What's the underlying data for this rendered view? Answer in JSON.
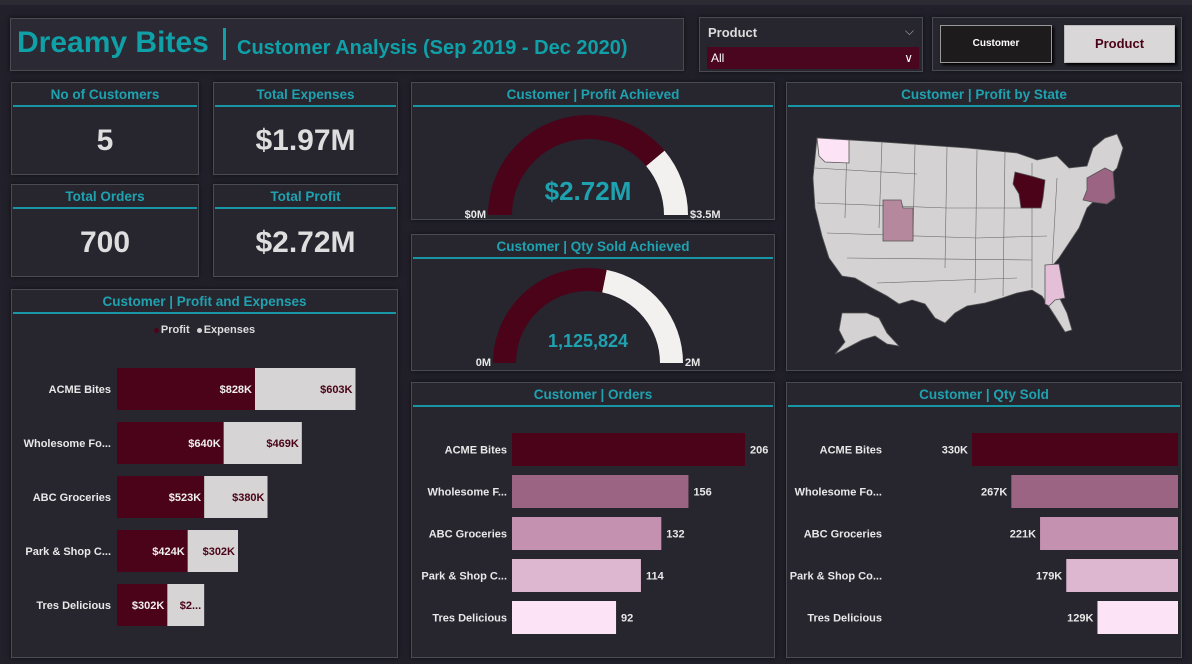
{
  "header": {
    "brand": "Dreamy Bites",
    "subtitle": "Customer Analysis (Sep 2019 - Dec 2020)"
  },
  "slicer": {
    "label": "Product",
    "value": "All"
  },
  "buttons": {
    "customer": "Customer",
    "product": "Product"
  },
  "kpis": [
    {
      "title": "No of Customers",
      "value": "5"
    },
    {
      "title": "Total Expenses",
      "value": "$1.97M"
    },
    {
      "title": "Total Orders",
      "value": "700"
    },
    {
      "title": "Total Profit",
      "value": "$2.72M"
    }
  ],
  "colors": {
    "accent": "#1fa2b0",
    "maroon": "#4a0318",
    "gauge_bg": "#f3f1ef"
  },
  "chart_data": [
    {
      "id": "profit-gauge",
      "type": "gauge",
      "title": "Customer | Profit Achieved",
      "value": 2720000,
      "min": 0,
      "max": 3500000,
      "value_label": "$2.72M",
      "min_label": "$0M",
      "max_label": "$3.5M"
    },
    {
      "id": "qty-gauge",
      "type": "gauge",
      "title": "Customer | Qty Sold Achieved",
      "value": 1125824,
      "min": 0,
      "max": 2000000,
      "value_label": "1,125,824",
      "min_label": "0M",
      "max_label": "2M"
    },
    {
      "id": "profit-expenses",
      "type": "bar",
      "stacked": true,
      "orientation": "horizontal",
      "title": "Customer | Profit and Expenses",
      "categories": [
        "ACME Bites",
        "Wholesome Fo...",
        "ABC Groceries",
        "Park & Shop C...",
        "Tres Delicious"
      ],
      "series": [
        {
          "name": "Profit",
          "color": "#4a0318",
          "values": [
            828,
            640,
            523,
            424,
            302
          ],
          "labels": [
            "$828K",
            "$640K",
            "$523K",
            "$424K",
            "$302K"
          ]
        },
        {
          "name": "Expenses",
          "color": "#d6d4d4",
          "values": [
            603,
            469,
            380,
            302,
            221
          ],
          "labels": [
            "$603K",
            "$469K",
            "$380K",
            "$302K",
            "$2..."
          ]
        }
      ],
      "legend": "top-center"
    },
    {
      "id": "orders",
      "type": "bar",
      "orientation": "horizontal",
      "title": "Customer | Orders",
      "categories": [
        "ACME Bites",
        "Wholesome F...",
        "ABC Groceries",
        "Park & Shop C...",
        "Tres Delicious"
      ],
      "values": [
        206,
        156,
        132,
        114,
        92
      ],
      "labels": [
        "206",
        "156",
        "132",
        "114",
        "92"
      ],
      "colors": [
        "#4a0318",
        "#9a6482",
        "#c491b0",
        "#ddb6d0",
        "#fce3f5"
      ]
    },
    {
      "id": "qty-sold",
      "type": "bar",
      "orientation": "horizontal",
      "title": "Customer | Qty Sold",
      "categories": [
        "ACME Bites",
        "Wholesome Fo...",
        "ABC Groceries",
        "Park & Shop Co...",
        "Tres Delicious"
      ],
      "values": [
        330,
        267,
        221,
        179,
        129
      ],
      "labels": [
        "330K",
        "267K",
        "221K",
        "179K",
        "129K"
      ],
      "colors": [
        "#4a0318",
        "#9a6482",
        "#c491b0",
        "#ddb6d0",
        "#fce3f5"
      ]
    },
    {
      "id": "profit-map",
      "type": "map",
      "title": "Customer | Profit by State",
      "highlighted": [
        {
          "state": "Wisconsin",
          "color": "#4a0318"
        },
        {
          "state": "New York",
          "color": "#9a6482"
        },
        {
          "state": "Utah",
          "color": "#b6889e"
        },
        {
          "state": "Alabama",
          "color": "#e5bfd8"
        },
        {
          "state": "Washington",
          "color": "#fce3f5"
        }
      ]
    }
  ]
}
